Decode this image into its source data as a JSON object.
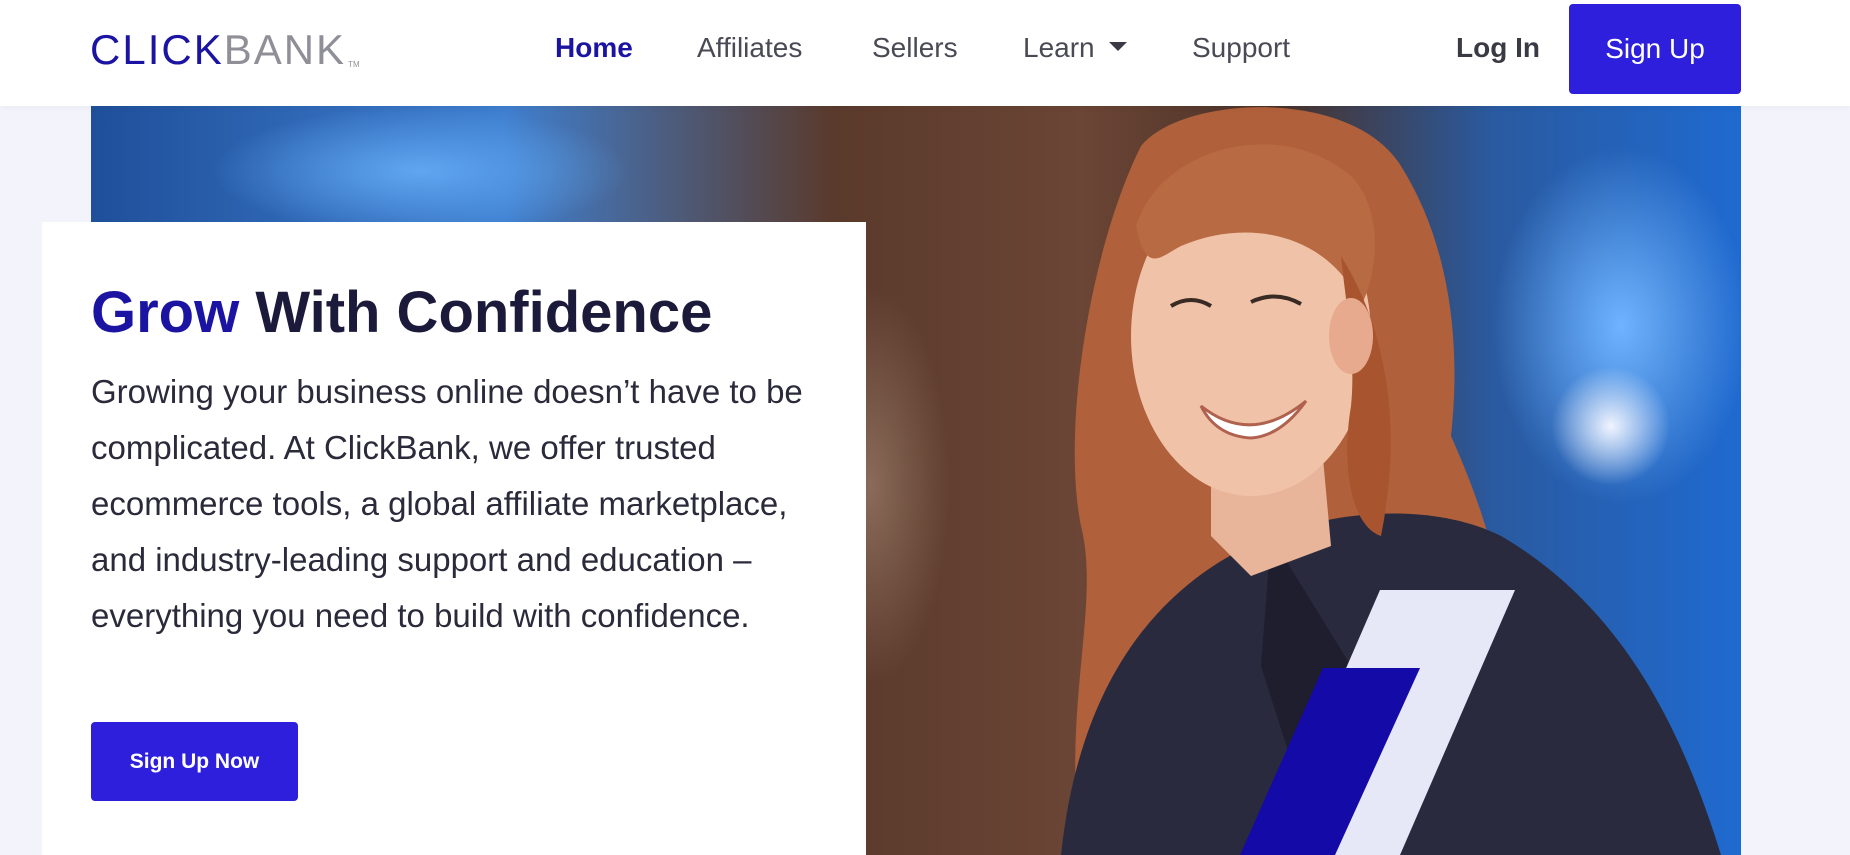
{
  "brand": {
    "logo_primary": "CLICK",
    "logo_secondary": "BANK",
    "logo_tm": "TM"
  },
  "nav": {
    "items": [
      {
        "label": "Home",
        "active": true
      },
      {
        "label": "Affiliates"
      },
      {
        "label": "Sellers"
      },
      {
        "label": "Learn",
        "has_dropdown": true
      },
      {
        "label": "Support"
      }
    ],
    "login_label": "Log In",
    "signup_label": "Sign Up"
  },
  "hero": {
    "headline_accent": "Grow",
    "headline_rest": " With Confidence",
    "body": "Growing your business online doesn’t have to be complicated. At ClickBank, we offer trusted ecommerce tools, a global affiliate marketplace, and industry-leading support and education – everything you need to build with confidence.",
    "cta_label": "Sign Up Now"
  },
  "colors": {
    "brand_primary": "#1b14a3",
    "button": "#2d1fdc",
    "stripe_light": "#e6e8f8",
    "stripe_dark": "#130aa8"
  }
}
